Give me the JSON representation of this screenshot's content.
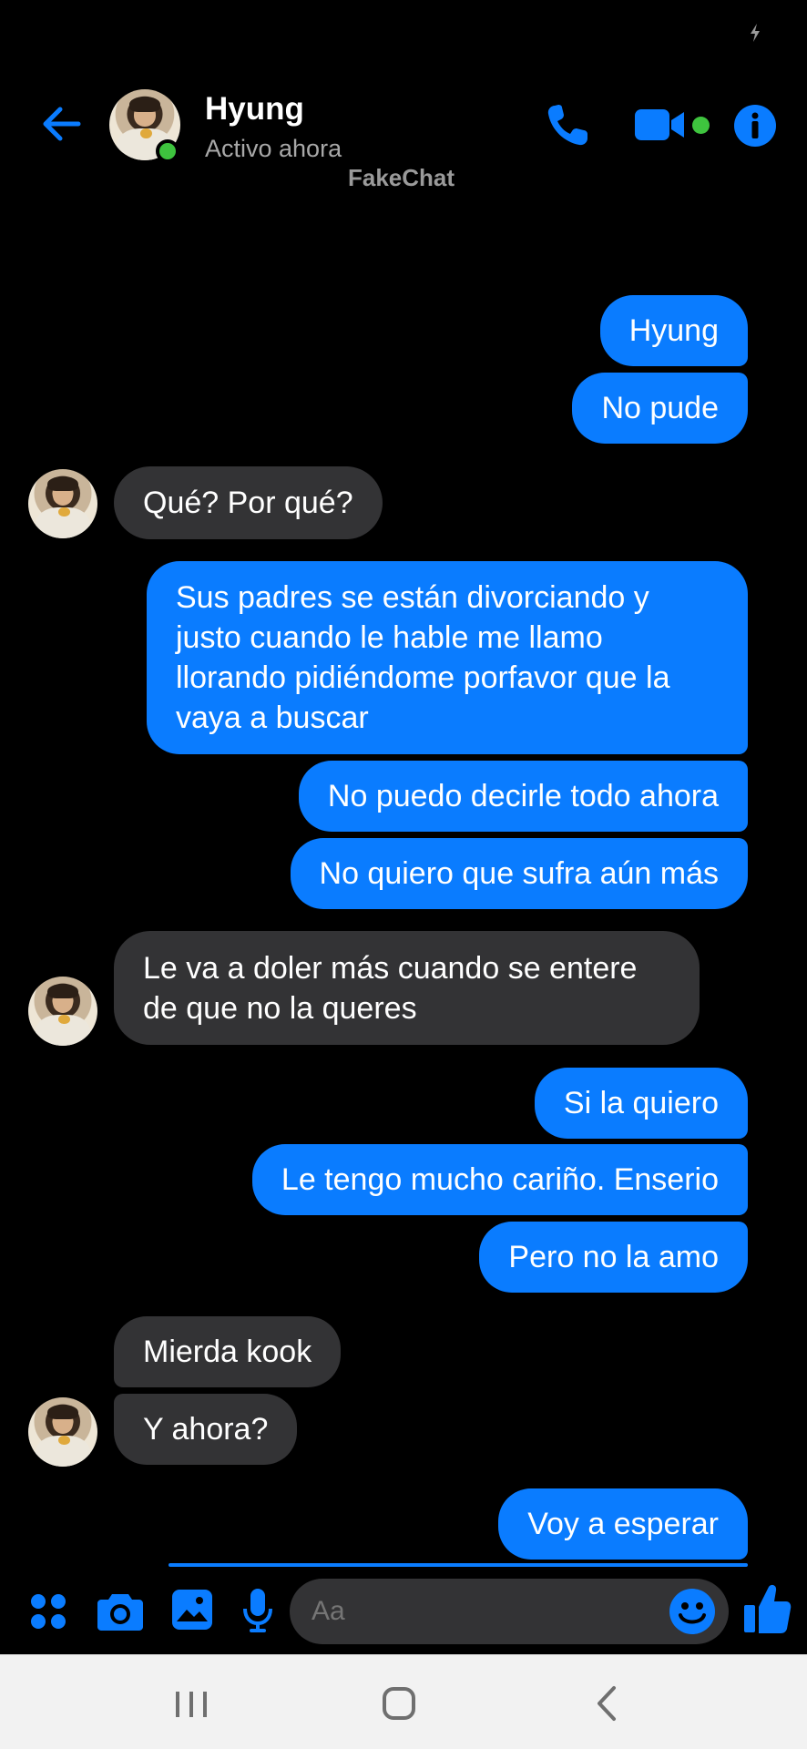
{
  "header": {
    "contact_name": "Hyung",
    "contact_status": "Activo ahora",
    "watermark": "FakeChat"
  },
  "messages": [
    {
      "dir": "out",
      "text": "Hyung"
    },
    {
      "dir": "out",
      "text": "No pude"
    },
    {
      "dir": "in",
      "text": "Qué? Por qué?"
    },
    {
      "dir": "out",
      "text": "Sus padres se están divorciando y justo cuando le hable me llamo llorando pidiéndome porfavor que la vaya a buscar"
    },
    {
      "dir": "out",
      "text": "No puedo decirle todo ahora"
    },
    {
      "dir": "out",
      "text": "No quiero que sufra aún más"
    },
    {
      "dir": "in",
      "text": "Le va a doler más cuando se entere de que no la queres"
    },
    {
      "dir": "out",
      "text": "Si la quiero"
    },
    {
      "dir": "out",
      "text": "Le tengo mucho cariño. Enserio"
    },
    {
      "dir": "out",
      "text": "Pero no la amo"
    },
    {
      "dir": "in",
      "text": "Mierda kook"
    },
    {
      "dir": "in",
      "text": "Y ahora?"
    },
    {
      "dir": "out",
      "text": "Voy a esperar"
    }
  ],
  "composer": {
    "placeholder": "Aa"
  },
  "icons": {
    "back": "arrow-left-icon",
    "call": "phone-icon",
    "video": "video-camera-icon",
    "info": "info-icon",
    "apps": "four-dots-icon",
    "camera": "camera-icon",
    "gallery": "image-icon",
    "mic": "microphone-icon",
    "emoji": "smiley-icon",
    "like": "thumbs-up-icon"
  },
  "colors": {
    "accent": "#0a7cff",
    "incoming_bubble": "#333335",
    "online": "#3ec43e",
    "background": "#000000"
  }
}
